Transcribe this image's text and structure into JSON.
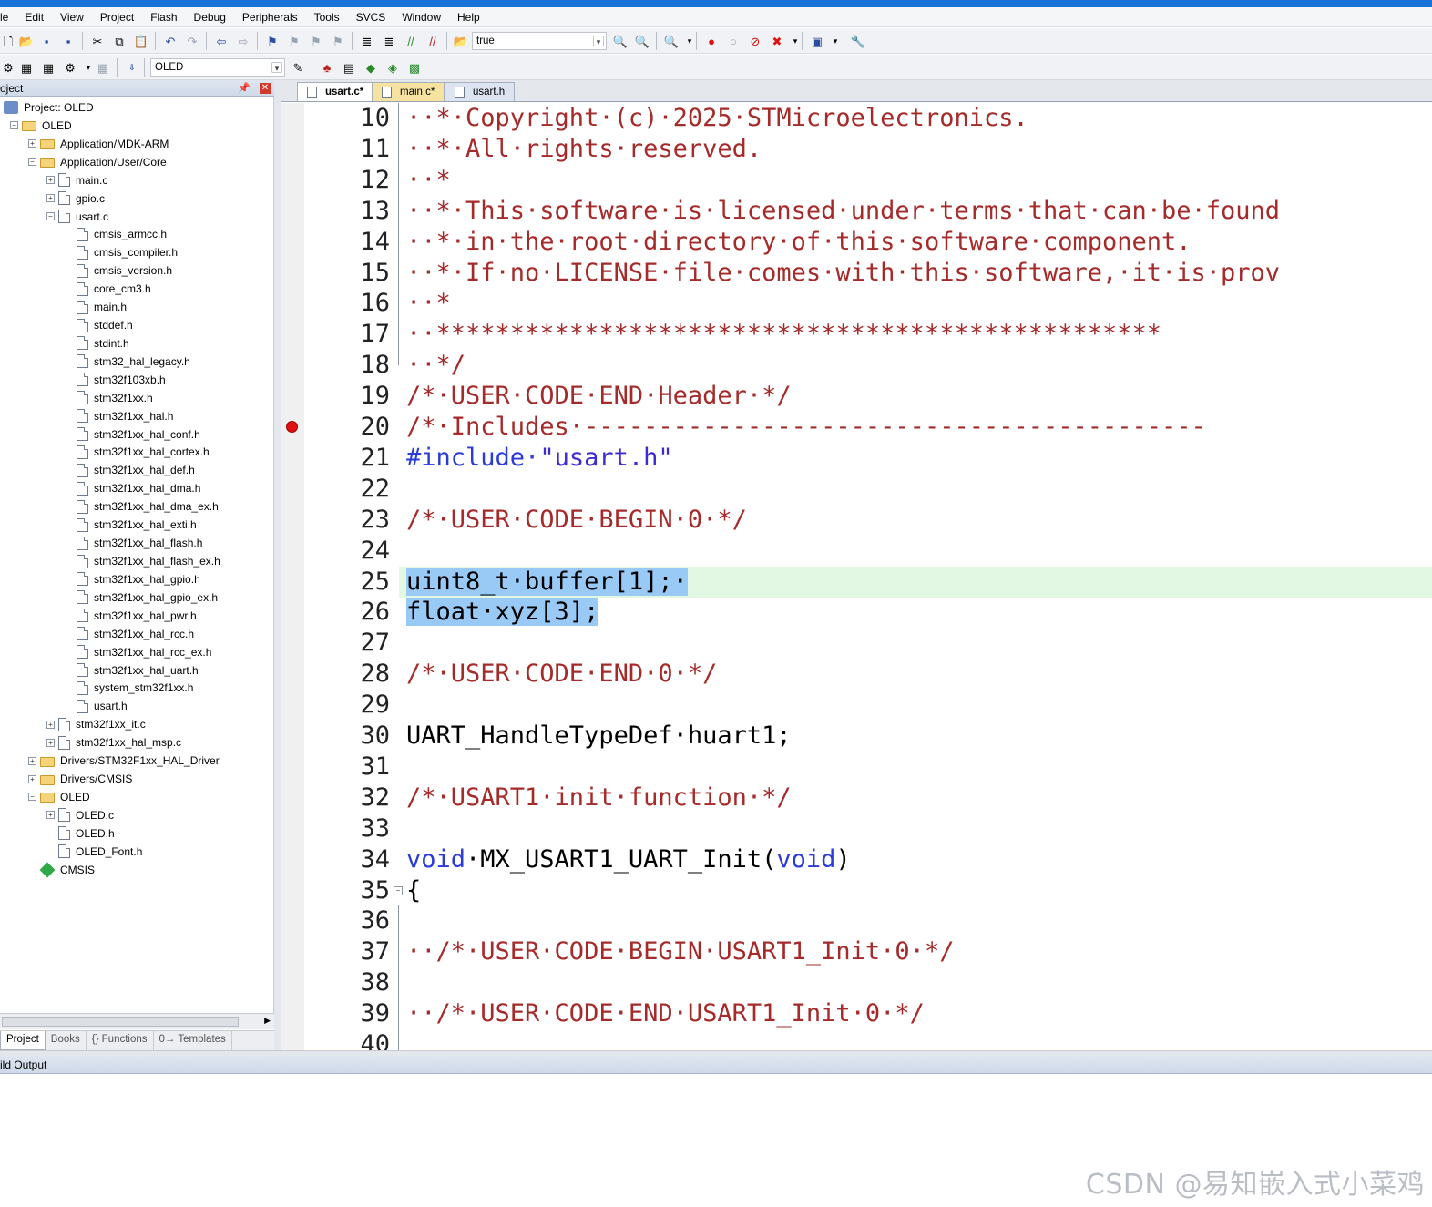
{
  "menu": [
    "le",
    "Edit",
    "View",
    "Project",
    "Flash",
    "Debug",
    "Peripherals",
    "Tools",
    "SVCS",
    "Window",
    "Help"
  ],
  "toolbar1": {
    "find_value": "true"
  },
  "toolbar2": {
    "target_value": "OLED"
  },
  "project_panel": {
    "header": "oject",
    "tree": [
      {
        "label": "Project: OLED",
        "depth": 0,
        "icon": "project-icon",
        "expander": ""
      },
      {
        "label": "OLED",
        "depth": 1,
        "icon": "folder-icon",
        "expander": "-"
      },
      {
        "label": "Application/MDK-ARM",
        "depth": 2,
        "icon": "folder-icon",
        "expander": "+"
      },
      {
        "label": "Application/User/Core",
        "depth": 2,
        "icon": "folder-icon",
        "expander": "-"
      },
      {
        "label": "main.c",
        "depth": 3,
        "icon": "file-icon",
        "expander": "+"
      },
      {
        "label": "gpio.c",
        "depth": 3,
        "icon": "file-icon",
        "expander": "+"
      },
      {
        "label": "usart.c",
        "depth": 3,
        "icon": "file-icon",
        "expander": "-"
      },
      {
        "label": "cmsis_armcc.h",
        "depth": 4,
        "icon": "file-icon",
        "expander": ""
      },
      {
        "label": "cmsis_compiler.h",
        "depth": 4,
        "icon": "file-icon",
        "expander": ""
      },
      {
        "label": "cmsis_version.h",
        "depth": 4,
        "icon": "file-icon",
        "expander": ""
      },
      {
        "label": "core_cm3.h",
        "depth": 4,
        "icon": "file-icon",
        "expander": ""
      },
      {
        "label": "main.h",
        "depth": 4,
        "icon": "file-icon",
        "expander": ""
      },
      {
        "label": "stddef.h",
        "depth": 4,
        "icon": "file-icon",
        "expander": ""
      },
      {
        "label": "stdint.h",
        "depth": 4,
        "icon": "file-icon",
        "expander": ""
      },
      {
        "label": "stm32_hal_legacy.h",
        "depth": 4,
        "icon": "file-icon",
        "expander": ""
      },
      {
        "label": "stm32f103xb.h",
        "depth": 4,
        "icon": "file-icon",
        "expander": ""
      },
      {
        "label": "stm32f1xx.h",
        "depth": 4,
        "icon": "file-icon",
        "expander": ""
      },
      {
        "label": "stm32f1xx_hal.h",
        "depth": 4,
        "icon": "file-icon",
        "expander": ""
      },
      {
        "label": "stm32f1xx_hal_conf.h",
        "depth": 4,
        "icon": "file-icon",
        "expander": ""
      },
      {
        "label": "stm32f1xx_hal_cortex.h",
        "depth": 4,
        "icon": "file-icon",
        "expander": ""
      },
      {
        "label": "stm32f1xx_hal_def.h",
        "depth": 4,
        "icon": "file-icon",
        "expander": ""
      },
      {
        "label": "stm32f1xx_hal_dma.h",
        "depth": 4,
        "icon": "file-icon",
        "expander": ""
      },
      {
        "label": "stm32f1xx_hal_dma_ex.h",
        "depth": 4,
        "icon": "file-icon",
        "expander": ""
      },
      {
        "label": "stm32f1xx_hal_exti.h",
        "depth": 4,
        "icon": "file-icon",
        "expander": ""
      },
      {
        "label": "stm32f1xx_hal_flash.h",
        "depth": 4,
        "icon": "file-icon",
        "expander": ""
      },
      {
        "label": "stm32f1xx_hal_flash_ex.h",
        "depth": 4,
        "icon": "file-icon",
        "expander": ""
      },
      {
        "label": "stm32f1xx_hal_gpio.h",
        "depth": 4,
        "icon": "file-icon",
        "expander": ""
      },
      {
        "label": "stm32f1xx_hal_gpio_ex.h",
        "depth": 4,
        "icon": "file-icon",
        "expander": ""
      },
      {
        "label": "stm32f1xx_hal_pwr.h",
        "depth": 4,
        "icon": "file-icon",
        "expander": ""
      },
      {
        "label": "stm32f1xx_hal_rcc.h",
        "depth": 4,
        "icon": "file-icon",
        "expander": ""
      },
      {
        "label": "stm32f1xx_hal_rcc_ex.h",
        "depth": 4,
        "icon": "file-icon",
        "expander": ""
      },
      {
        "label": "stm32f1xx_hal_uart.h",
        "depth": 4,
        "icon": "file-icon",
        "expander": ""
      },
      {
        "label": "system_stm32f1xx.h",
        "depth": 4,
        "icon": "file-icon",
        "expander": ""
      },
      {
        "label": "usart.h",
        "depth": 4,
        "icon": "file-icon",
        "expander": ""
      },
      {
        "label": "stm32f1xx_it.c",
        "depth": 3,
        "icon": "file-icon",
        "expander": "+"
      },
      {
        "label": "stm32f1xx_hal_msp.c",
        "depth": 3,
        "icon": "file-icon",
        "expander": "+"
      },
      {
        "label": "Drivers/STM32F1xx_HAL_Driver",
        "depth": 2,
        "icon": "folder-icon",
        "expander": "+"
      },
      {
        "label": "Drivers/CMSIS",
        "depth": 2,
        "icon": "folder-icon",
        "expander": "+"
      },
      {
        "label": "OLED",
        "depth": 2,
        "icon": "folder-icon",
        "expander": "-"
      },
      {
        "label": "OLED.c",
        "depth": 3,
        "icon": "file-icon",
        "expander": "+"
      },
      {
        "label": "OLED.h",
        "depth": 3,
        "icon": "file-icon",
        "expander": ""
      },
      {
        "label": "OLED_Font.h",
        "depth": 3,
        "icon": "file-icon",
        "expander": ""
      },
      {
        "label": "CMSIS",
        "depth": 2,
        "icon": "gem-icon",
        "expander": ""
      }
    ],
    "tabs": [
      {
        "label": "Project",
        "icon": "project-icon"
      },
      {
        "label": "Books",
        "icon": "books-icon"
      },
      {
        "label": "{} Functions",
        "icon": "functions-icon"
      },
      {
        "label": "0→ Templates",
        "icon": "templates-icon"
      }
    ]
  },
  "editor_tabs": [
    {
      "label": "usart.c*",
      "active": true
    },
    {
      "label": "main.c*",
      "active": false
    },
    {
      "label": "usart.h",
      "active": false
    }
  ],
  "code_lines": [
    {
      "n": "10",
      "parts": [
        [
          "cmt",
          "··*·Copyright·(c)·2025·STMicroelectronics."
        ]
      ]
    },
    {
      "n": "11",
      "parts": [
        [
          "cmt",
          "··*·All·rights·reserved."
        ]
      ]
    },
    {
      "n": "12",
      "parts": [
        [
          "cmt",
          "··*"
        ]
      ]
    },
    {
      "n": "13",
      "parts": [
        [
          "cmt",
          "··*·This·software·is·licensed·under·terms·that·can·be·found"
        ]
      ]
    },
    {
      "n": "14",
      "parts": [
        [
          "cmt",
          "··*·in·the·root·directory·of·this·software·component."
        ]
      ]
    },
    {
      "n": "15",
      "parts": [
        [
          "cmt",
          "··*·If·no·LICENSE·file·comes·with·this·software,·it·is·prov"
        ]
      ]
    },
    {
      "n": "16",
      "parts": [
        [
          "cmt",
          "··*"
        ]
      ]
    },
    {
      "n": "17",
      "parts": [
        [
          "cmt",
          "··*************************************************"
        ]
      ]
    },
    {
      "n": "18",
      "parts": [
        [
          "cmt",
          "··*/"
        ]
      ]
    },
    {
      "n": "19",
      "parts": [
        [
          "cmt",
          "/*·USER·CODE·END·Header·*/"
        ]
      ]
    },
    {
      "n": "20",
      "parts": [
        [
          "cmt",
          "/*·Includes·------------------------------------------"
        ]
      ],
      "breakpoint": true
    },
    {
      "n": "21",
      "parts": [
        [
          "pp",
          "#include·"
        ],
        [
          "str",
          "\"usart.h\""
        ]
      ]
    },
    {
      "n": "22",
      "parts": []
    },
    {
      "n": "23",
      "parts": [
        [
          "cmt",
          "/*·USER·CODE·BEGIN·0·*/"
        ]
      ]
    },
    {
      "n": "24",
      "parts": []
    },
    {
      "n": "25",
      "parts": [
        [
          "plain sel",
          "uint8_t·buffer[1];·"
        ]
      ],
      "current": true
    },
    {
      "n": "26",
      "parts": [
        [
          "plain sel",
          "float·xyz[3];"
        ]
      ]
    },
    {
      "n": "27",
      "parts": []
    },
    {
      "n": "28",
      "parts": [
        [
          "cmt",
          "/*·USER·CODE·END·0·*/"
        ]
      ]
    },
    {
      "n": "29",
      "parts": []
    },
    {
      "n": "30",
      "parts": [
        [
          "plain",
          "UART_HandleTypeDef·huart1;"
        ]
      ]
    },
    {
      "n": "31",
      "parts": []
    },
    {
      "n": "32",
      "parts": [
        [
          "cmt",
          "/*·USART1·init·function·*/"
        ]
      ]
    },
    {
      "n": "33",
      "parts": []
    },
    {
      "n": "34",
      "parts": [
        [
          "kw",
          "void"
        ],
        [
          "plain",
          "·MX_USART1_UART_Init("
        ],
        [
          "kw",
          "void"
        ],
        [
          "plain",
          ")"
        ]
      ]
    },
    {
      "n": "35",
      "parts": [
        [
          "plain",
          "{"
        ]
      ],
      "fold": true
    },
    {
      "n": "36",
      "parts": []
    },
    {
      "n": "37",
      "parts": [
        [
          "cmt",
          "··/*·USER·CODE·BEGIN·USART1_Init·0·*/"
        ]
      ]
    },
    {
      "n": "38",
      "parts": []
    },
    {
      "n": "39",
      "parts": [
        [
          "cmt",
          "··/*·USER·CODE·END·USART1_Init·0·*/"
        ]
      ]
    },
    {
      "n": "40",
      "parts": []
    }
  ],
  "build_output": {
    "header": "ild Output"
  },
  "watermark": "CSDN @易知嵌入式小菜鸡",
  "colors": {
    "comment": "#a52a2a",
    "keyword": "#2a3bd6",
    "selection": "#99c9f5",
    "current_line": "#e2f8e2",
    "breakpoint": "#e01010"
  }
}
